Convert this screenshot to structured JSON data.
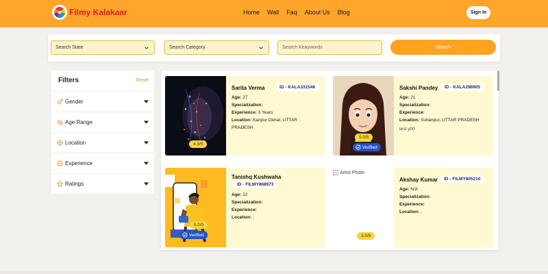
{
  "header": {
    "brand": "Filmy Kalakaar",
    "nav": [
      "Home",
      "Wall",
      "Faq",
      "About Us",
      "Blog"
    ],
    "sign_in": "Sign In",
    "colors": {
      "bar": "#ffa52a",
      "brand_text": "#d81f1f"
    }
  },
  "search": {
    "state_label": "Search State",
    "category_label": "Search Category",
    "keywords_placeholder": "Search Keaywords",
    "button": "Search"
  },
  "filters": {
    "title": "Filters",
    "reset": "Reset",
    "items": [
      {
        "label": "Gender",
        "icon": "gender-icon"
      },
      {
        "label": "Age Range",
        "icon": "age-range-icon"
      },
      {
        "label": "Location",
        "icon": "location-icon"
      },
      {
        "label": "Experience",
        "icon": "experience-icon"
      },
      {
        "label": "Ratings",
        "icon": "star-icon"
      }
    ]
  },
  "labels": {
    "age": "Age:",
    "specialization": "Specialization:",
    "experience": "Experience:",
    "location": "Location:",
    "verified": "Verified",
    "artist_photo_alt": "Artist Photo"
  },
  "artists": [
    {
      "name": "Sarita Verma",
      "id": "ID - KALA331548",
      "age": "27",
      "specialization": "",
      "experience": "3 Years",
      "location_line1": "Kanpur Dehat, UTTAR",
      "location_line2": "PRADESH",
      "rating": "4.3/5",
      "verified": false
    },
    {
      "name": "Sakshi Pandey",
      "id": "ID - KALA298905",
      "age": "21",
      "specialization": "",
      "experience": "",
      "location_line1": "Sultanpur, UTTAR PRADESH",
      "note": "test y00",
      "rating": "5.0/5",
      "verified": true
    },
    {
      "name": "Tanishq Kushwaha",
      "id": "ID - FILMY868973",
      "age": "22",
      "specialization": "",
      "experience": "",
      "location_line1": ",",
      "rating": "5.0/5",
      "verified": true
    },
    {
      "name": "Akshay Kumar",
      "id": "ID - FILMY805210",
      "age": "N/A",
      "specialization": "",
      "experience": "",
      "location_line1": ",",
      "rating": "3.0/5",
      "verified": false
    }
  ]
}
